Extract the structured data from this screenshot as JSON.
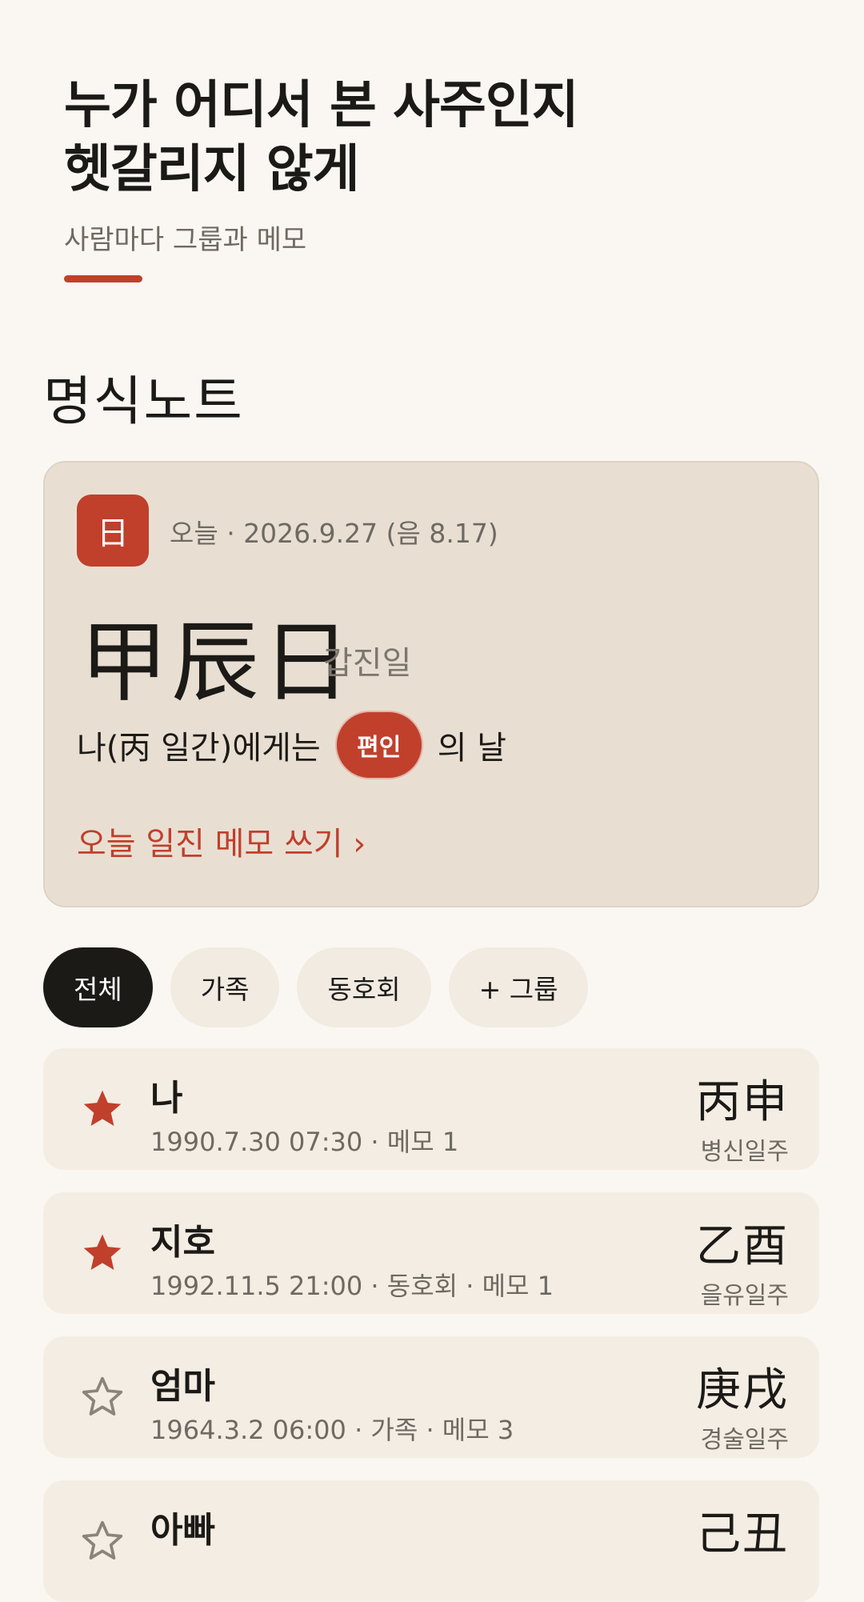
{
  "promo": {
    "title_line1": "누가 어디서 본 사주인지",
    "title_line2": "헷갈리지 않게",
    "subtitle": "사람마다 그룹과 메모"
  },
  "app": {
    "title": "명식노트"
  },
  "today": {
    "badge": "日",
    "date": "오늘 · 2026.9.27 (음 8.17)",
    "ganji": "甲辰日",
    "ganji_reading": "갑진일",
    "relation_prefix": "나(丙 일간)에게는",
    "relation_chip": "편인",
    "relation_suffix": "의 날",
    "memo_link": "오늘 일진 메모 쓰기 ›"
  },
  "filters": {
    "all": "전체",
    "family": "가족",
    "club": "동호회",
    "add_group": "+ 그룹"
  },
  "people": [
    {
      "name": "나",
      "meta": "1990.7.30 07:30 · 메모 1",
      "pillar": "丙申",
      "reading": "병신일주",
      "favorite": true
    },
    {
      "name": "지호",
      "meta": "1992.11.5 21:00 · 동호회 · 메모 1",
      "pillar": "乙酉",
      "reading": "을유일주",
      "favorite": true
    },
    {
      "name": "엄마",
      "meta": "1964.3.2 06:00 · 가족 · 메모 3",
      "pillar": "庚戌",
      "reading": "경술일주",
      "favorite": false
    },
    {
      "name": "아빠",
      "meta": "",
      "pillar": "己丑",
      "reading": "",
      "favorite": false
    }
  ],
  "colors": {
    "accent": "#c0402c",
    "background": "#faf7f2",
    "card": "#e8dfd2",
    "dark": "#1c1a17"
  }
}
